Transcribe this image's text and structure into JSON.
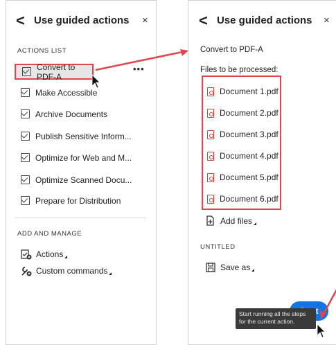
{
  "left": {
    "title": "Use guided actions",
    "back_glyph": "<",
    "close_glyph": "×",
    "actions_list_label": "ACTIONS LIST",
    "actions": [
      {
        "label": "Convert to PDF-A",
        "selected": true
      },
      {
        "label": "Make Accessible"
      },
      {
        "label": "Archive Documents"
      },
      {
        "label": "Publish Sensitive Inform..."
      },
      {
        "label": "Optimize for Web and M..."
      },
      {
        "label": "Optimize Scanned Docu..."
      },
      {
        "label": "Prepare for Distribution"
      }
    ],
    "more_glyph": "•••",
    "add_manage_label": "ADD AND MANAGE",
    "tools": [
      {
        "label": "Actions",
        "icon": "actions-icon"
      },
      {
        "label": "Custom commands",
        "icon": "custom-commands-icon"
      }
    ]
  },
  "right": {
    "title": "Use guided actions",
    "back_glyph": "<",
    "close_glyph": "×",
    "action_name": "Convert to PDF-A",
    "files_label": "Files to be processed:",
    "files": [
      "Document 1.pdf",
      "Document 2.pdf",
      "Document 3.pdf",
      "Document 4.pdf",
      "Document 5.pdf",
      "Document 6.pdf"
    ],
    "add_files_label": "Add files",
    "untitled_label": "UNTITLED",
    "save_as_label": "Save as",
    "tooltip_text": "Start running all the steps for the current action.",
    "start_label": "Start"
  },
  "colors": {
    "highlight": "#e0474c",
    "accent": "#1473e6"
  }
}
